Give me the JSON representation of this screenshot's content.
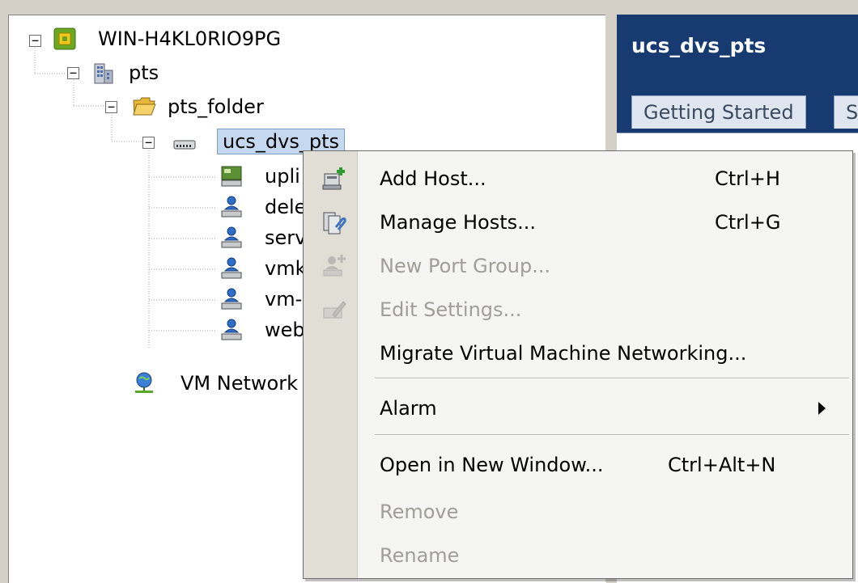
{
  "tree": {
    "root": "WIN-H4KL0RIO9PG",
    "datacenter": "pts",
    "folder": "pts_folder",
    "switch": "ucs_dvs_pts",
    "portgroups": [
      "upli",
      "dele",
      "serv",
      "vmk",
      "vm-",
      "web"
    ],
    "network": "VM Network",
    "expander_symbol": "−"
  },
  "detail": {
    "title": "ucs_dvs_pts",
    "tabs": [
      "Getting Started",
      "S"
    ]
  },
  "context_menu": {
    "items": [
      {
        "label": "Add Host...",
        "shortcut": "Ctrl+H",
        "icon": "add-host-icon",
        "enabled": true
      },
      {
        "label": "Manage Hosts...",
        "shortcut": "Ctrl+G",
        "icon": "manage-hosts-icon",
        "enabled": true
      },
      {
        "label": "New Port Group...",
        "shortcut": "",
        "icon": "new-port-group-icon",
        "enabled": false
      },
      {
        "label": "Edit Settings...",
        "shortcut": "",
        "icon": "edit-settings-icon",
        "enabled": false
      },
      {
        "label": "Migrate Virtual Machine Networking...",
        "shortcut": "",
        "icon": "",
        "enabled": true
      },
      {
        "label": "Alarm",
        "shortcut": "",
        "icon": "",
        "enabled": true,
        "submenu": true
      },
      {
        "label": "Open in New Window...",
        "shortcut": "Ctrl+Alt+N",
        "icon": "",
        "enabled": true
      },
      {
        "label": "Remove",
        "shortcut": "",
        "icon": "",
        "enabled": false
      },
      {
        "label": "Rename",
        "shortcut": "",
        "icon": "",
        "enabled": false
      }
    ]
  },
  "colors": {
    "header_bg": "#173b71",
    "selection_bg": "#c4d8ef",
    "disabled_text": "#a09e98",
    "menu_bg": "#f5f5f3"
  }
}
